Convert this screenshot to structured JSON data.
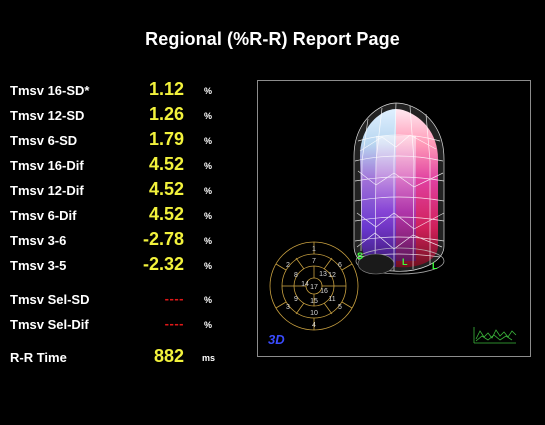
{
  "page": {
    "title": "Regional (%R-R) Report Page"
  },
  "metrics": [
    {
      "label": "Tmsv 16-SD*",
      "value": "1.12",
      "unit": "%"
    },
    {
      "label": "Tmsv 12-SD",
      "value": "1.26",
      "unit": "%"
    },
    {
      "label": "Tmsv 6-SD",
      "value": "1.79",
      "unit": "%"
    },
    {
      "label": "Tmsv 16-Dif",
      "value": "4.52",
      "unit": "%"
    },
    {
      "label": "Tmsv 12-Dif",
      "value": "4.52",
      "unit": "%"
    },
    {
      "label": "Tmsv 6-Dif",
      "value": "4.52",
      "unit": "%"
    },
    {
      "label": "Tmsv 3-6",
      "value": "-2.78",
      "unit": "%"
    },
    {
      "label": "Tmsv 3-5",
      "value": "-2.32",
      "unit": "%"
    }
  ],
  "selected_metrics": [
    {
      "label": "Tmsv Sel-SD",
      "value": "----",
      "unit": "%"
    },
    {
      "label": "Tmsv Sel-Dif",
      "value": "----",
      "unit": "%"
    }
  ],
  "rr_time": {
    "label": "R-R Time",
    "value": "882",
    "unit": "ms"
  },
  "view": {
    "badge": "3D",
    "bullseye_segments": [
      "1",
      "2",
      "3",
      "4",
      "5",
      "6",
      "7",
      "8",
      "9",
      "10",
      "11",
      "12",
      "13",
      "14",
      "15",
      "16",
      "17"
    ],
    "markers": [
      "S",
      "L",
      "L"
    ],
    "colors": {
      "value_yellow": "#f2f23c",
      "dash_red": "#e01818",
      "bullseye_gold": "#c8a040",
      "marker_green": "#3cff3c",
      "badge_blue": "#3a4cff"
    }
  }
}
